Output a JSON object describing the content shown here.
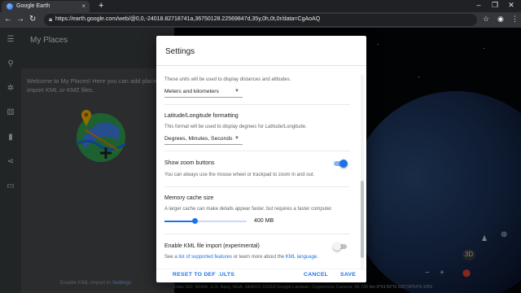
{
  "browser": {
    "tab_title": "Google Earth",
    "tab_close": "×",
    "new_tab": "+",
    "url": "https://earth.google.com/web/@0,0,-24018.82718741a,36750128.22569847d,35y,0h,0t,0r/data=CgAoAQ",
    "window_controls": [
      "–",
      "❐",
      "✕"
    ]
  },
  "sidebar": {
    "icons": [
      "menu-icon",
      "search-icon",
      "voyager-icon",
      "feeling-lucky-icon",
      "my-places-icon",
      "share-icon",
      "measure-icon"
    ]
  },
  "my_places": {
    "title": "My Places",
    "welcome": "Welcome to My Places! Here you can add places and import KML or KMZ files.",
    "footer_prefix": "Enable KML import in ",
    "footer_link": "Settings"
  },
  "dialog": {
    "title": "Settings",
    "units_help": "These units will be used to display distances and altitudes.",
    "units_value": "Meters and kilometers",
    "latlon_label": "Latitude/Longitude formatting",
    "latlon_help": "This format will be used to display degrees for Latitude/Longitude.",
    "latlon_value": "Degrees, Minutes, Seconds",
    "zoom_label": "Show zoom buttons",
    "zoom_help": "You can always use the mouse wheel or trackpad to zoom in and out.",
    "zoom_on": true,
    "cache_label": "Memory cache size",
    "cache_help": "A larger cache can make details appear faster, but requires a faster computer.",
    "cache_value": "400 MB",
    "cache_fraction": 0.37,
    "kml_label": "Enable KML file import (experimental)",
    "kml_help_prefix": "See a ",
    "kml_help_link1": "list of supported features",
    "kml_help_middle": " or learn more about the ",
    "kml_help_link2": "KML language",
    "kml_help_suffix": ".",
    "kml_on": false,
    "reset_label": "RESET TO DEFAULTS",
    "cancel_label": "CANCEL",
    "save_label": "SAVE"
  },
  "earth_controls": {
    "view_3d": "3D",
    "zoom_out": "−",
    "zoom_in": "+"
  },
  "status": "Data SIO, NOAA, U.S. Navy, NGA, GEBCO  ©2018 Google  Landsat / Copernicus    Camera: 36,726 km   9°51'42\"N 120°24'54\"E   63%",
  "colors": {
    "accent": "#1a73e8",
    "toggle_on_track": "#8ab4f8",
    "toggle_off_track": "#bdc1c6"
  }
}
